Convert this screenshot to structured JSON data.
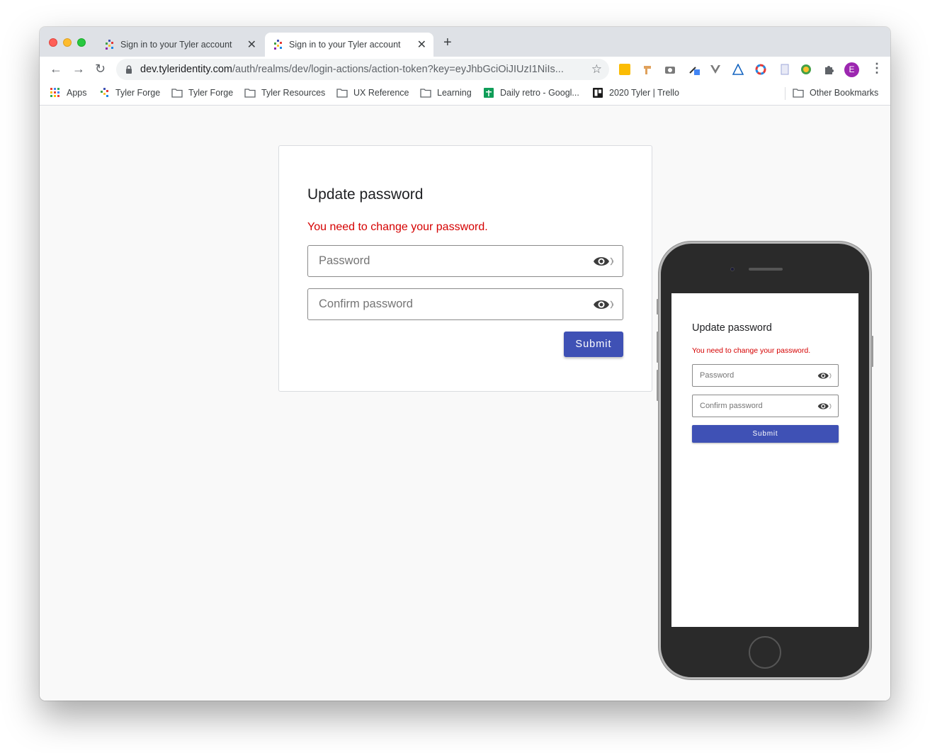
{
  "browser": {
    "tabs": [
      {
        "title": "Sign in to your Tyler account",
        "active": false
      },
      {
        "title": "Sign in to your Tyler account",
        "active": true
      }
    ],
    "new_tab_label": "+",
    "url_host": "dev.tyleridentity.com",
    "url_path": "/auth/realms/dev/login-actions/action-token?key=eyJhbGciOiJIUzI1NiIs...",
    "profile_initial": "E",
    "bookmarks": [
      {
        "label": "Apps",
        "icon": "apps-grid-icon"
      },
      {
        "label": "Tyler Forge",
        "icon": "tyler-forge-icon"
      },
      {
        "label": "Tyler Forge",
        "icon": "folder-icon"
      },
      {
        "label": "Tyler Resources",
        "icon": "folder-icon"
      },
      {
        "label": "UX Reference",
        "icon": "folder-icon"
      },
      {
        "label": "Learning",
        "icon": "folder-icon"
      },
      {
        "label": "Daily retro - Googl...",
        "icon": "google-sheets-icon"
      },
      {
        "label": "2020 Tyler | Trello",
        "icon": "trello-icon"
      }
    ],
    "other_bookmarks": "Other Bookmarks"
  },
  "form": {
    "title": "Update password",
    "error": "You need to change your password.",
    "password_placeholder": "Password",
    "confirm_placeholder": "Confirm password",
    "submit_label": "Submit"
  },
  "mobile": {
    "title": "Update password",
    "error": "You need to change your password.",
    "password_placeholder": "Password",
    "confirm_placeholder": "Confirm password",
    "submit_label": "Submit"
  },
  "colors": {
    "accent": "#3f51b5",
    "error": "#d50000",
    "avatar": "#9c27b0"
  }
}
